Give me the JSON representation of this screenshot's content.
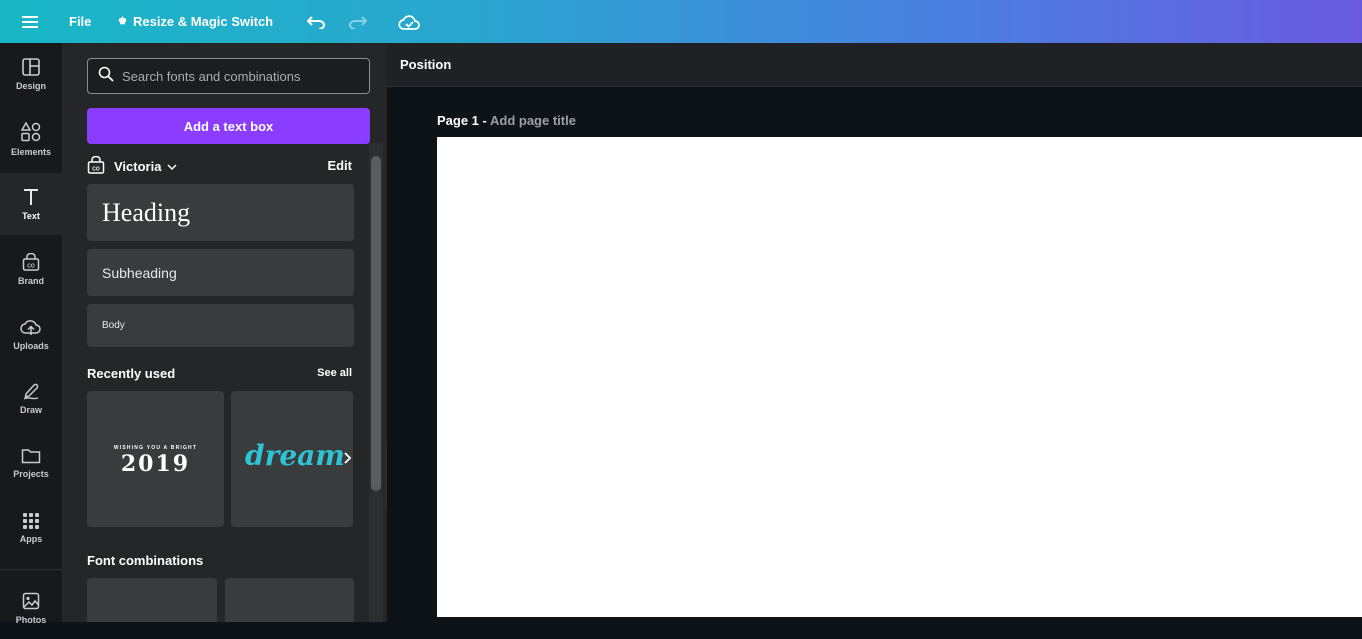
{
  "topbar": {
    "file_label": "File",
    "resize_label": "Resize & Magic Switch",
    "icons": [
      "menu-icon",
      "crown-icon",
      "undo-icon",
      "redo-icon",
      "cloud-saved-icon"
    ]
  },
  "rail": {
    "items": [
      {
        "label": "Design",
        "icon": "layout-icon"
      },
      {
        "label": "Elements",
        "icon": "shapes-icon"
      },
      {
        "label": "Text",
        "icon": "text-icon"
      },
      {
        "label": "Brand",
        "icon": "brand-kit-icon"
      },
      {
        "label": "Uploads",
        "icon": "upload-cloud-icon"
      },
      {
        "label": "Draw",
        "icon": "pen-icon"
      },
      {
        "label": "Projects",
        "icon": "folder-icon"
      },
      {
        "label": "Apps",
        "icon": "grid-icon"
      },
      {
        "label": "Photos",
        "icon": "photo-icon"
      }
    ],
    "active": "Text"
  },
  "panel": {
    "search_placeholder": "Search fonts and combinations",
    "add_text_box": "Add a text box",
    "brand_name": "Victoria",
    "edit_label": "Edit",
    "styles": {
      "heading": "Heading",
      "subheading": "Subheading",
      "body": "Body"
    },
    "recently_used": {
      "title": "Recently used",
      "see_all": "See all",
      "tile1_small": "WISHING YOU A BRIGHT",
      "tile1_big": "2019",
      "tile2_text": "dream"
    },
    "font_combinations": {
      "title": "Font combinations"
    }
  },
  "canvas": {
    "context_label": "Position",
    "page_label": "Page 1 -",
    "page_title_placeholder": "Add page title"
  },
  "colors": {
    "accent": "#8b3dff",
    "panel_bg": "#252627",
    "rail_bg": "#18191b",
    "canvas_bg": "#0e1318",
    "dream_teal": "#2ec4d6"
  }
}
